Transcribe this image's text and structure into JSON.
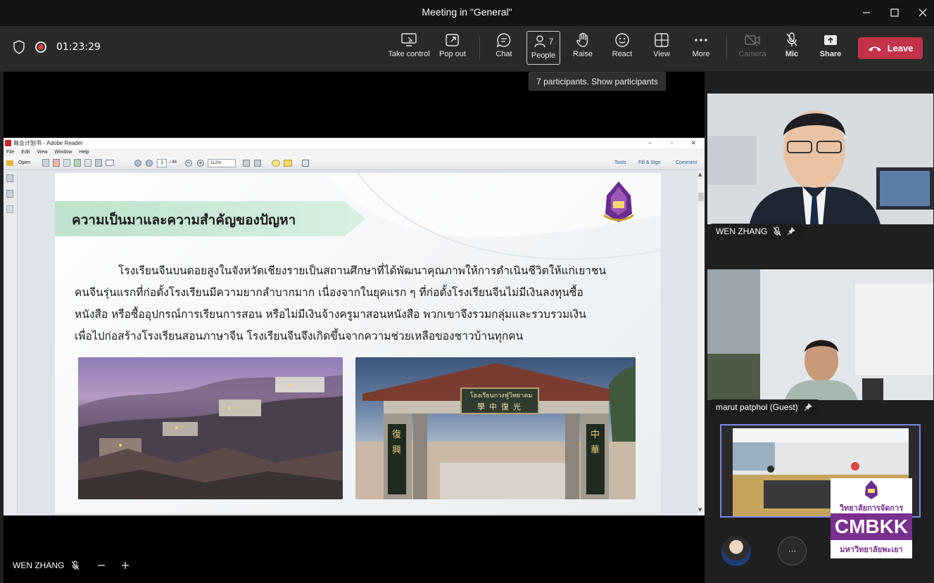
{
  "window": {
    "title": "Meeting in \"General\""
  },
  "toolbar": {
    "timer": "01:23:29",
    "buttons": {
      "take_control": "Take control",
      "pop_out": "Pop out",
      "chat": "Chat",
      "people": "People",
      "people_count": "7",
      "raise": "Raise",
      "react": "React",
      "view": "View",
      "more": "More",
      "camera": "Camera",
      "mic": "Mic",
      "share": "Share"
    },
    "leave": "Leave"
  },
  "tooltip": "7 participants. Show participants",
  "adobe": {
    "title": "商业计划书 - Adobe Reader",
    "menu": [
      "File",
      "Edit",
      "View",
      "Window",
      "Help"
    ],
    "open": "Open",
    "page": "3",
    "page_total": "/ 48",
    "zoom": "112%",
    "right_tools": [
      "Tools",
      "Fill & Sign",
      "Comment"
    ]
  },
  "slide": {
    "title": "ความเป็นมาและความสำคัญของปัญหา",
    "body_lines": [
      "โรงเรียนจีนบนดอยสูงในจังหวัดเชียงรายเป็นสถานศึกษาที่ได้พัฒนาคุณภาพให้การดำเนินชีวิตให้แก่เยาชน",
      "คนจีนรุ่นแรกที่ก่อตั้งโรงเรียนมีความยากลำบากมาก เนื่องจากในยุคแรก ๆ ที่ก่อตั้งโรงเรียนจีนไม่มีเงินลงทุนซื้อ",
      "หนังสือ หรือซื้ออุปกรณ์การเรียนการสอน หรือไม่มีเงินจ้างครูมาสอนหนังสือ พวกเขาจึงรวมกลุ่มและรวบรวมเงิน",
      "เพื่อไปก่อสร้างโรงเรียนสอนภาษาจีน โรงเรียนจีนจึงเกิดขึ้นจากความช่วยเหลือของชาวบ้านทุกคน"
    ],
    "gate_sign": "โฮงเรียนกวงฟู่วิทยาคม",
    "gate_chinese": "學中復光",
    "gate_left_column": "復興",
    "gate_right_column": "中華"
  },
  "participants": [
    {
      "name": "WEN ZHANG"
    },
    {
      "name": "marut patphol (Guest)"
    }
  ],
  "bottom_bar": {
    "name": "WEN ZHANG"
  },
  "watermark": {
    "line1": "วิทยาลัยการจัดการ",
    "line2": "CMBKK",
    "line3": "มหาวิทยาลัยพะเยา"
  },
  "more_circle": "···",
  "colors": {
    "leave": "#c4314b",
    "accent": "#7b83eb",
    "banner": "#bde3cc",
    "cmbkk": "#7a2e8e"
  }
}
